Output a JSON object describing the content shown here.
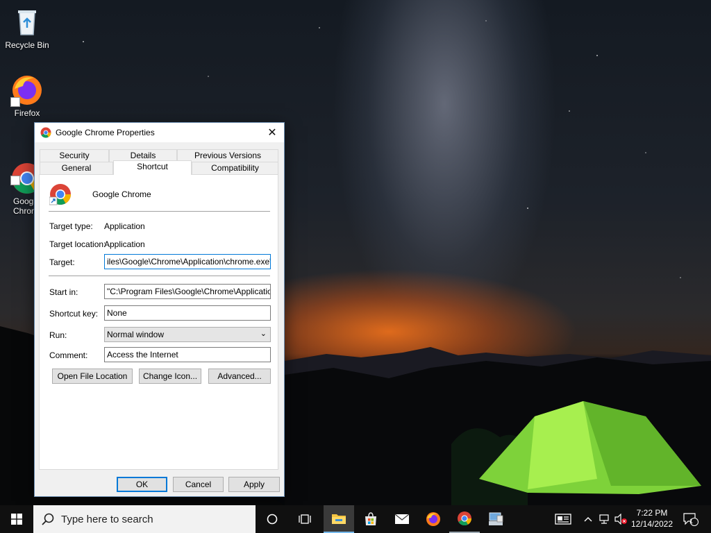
{
  "desktop": {
    "icons": [
      {
        "label": "Recycle Bin",
        "icon": "recycle-bin-icon"
      },
      {
        "label": "Firefox",
        "icon": "firefox-icon"
      },
      {
        "label": "Goog\nChron",
        "icon": "chrome-icon"
      }
    ]
  },
  "dialog": {
    "title": "Google Chrome Properties",
    "close_glyph": "✕",
    "tabs_row1": [
      "Security",
      "Details",
      "Previous Versions"
    ],
    "tabs_row2": [
      "General",
      "Shortcut",
      "Compatibility"
    ],
    "active_tab": "Shortcut",
    "app_name": "Google Chrome",
    "target_type_label": "Target type:",
    "target_type_value": "Application",
    "target_location_label": "Target location:",
    "target_location_value": "Application",
    "target_label": "Target:",
    "target_value": "iles\\Google\\Chrome\\Application\\chrome.exe\" --ig",
    "start_in_label": "Start in:",
    "start_in_value": "\"C:\\Program Files\\Google\\Chrome\\Application\"",
    "shortcut_key_label": "Shortcut key:",
    "shortcut_key_value": "None",
    "run_label": "Run:",
    "run_value": "Normal window",
    "comment_label": "Comment:",
    "comment_value": "Access the Internet",
    "buttons": {
      "open_file_location": "Open File Location",
      "change_icon": "Change Icon...",
      "advanced": "Advanced...",
      "ok": "OK",
      "cancel": "Cancel",
      "apply": "Apply"
    }
  },
  "taskbar": {
    "search_placeholder": "Type here to search",
    "time": "7:22 PM",
    "date": "12/14/2022",
    "notification_count": "1",
    "pinned": [
      "task-view",
      "file-explorer",
      "microsoft-store",
      "mail",
      "firefox",
      "chrome",
      "network-app"
    ]
  },
  "colors": {
    "accent": "#0078d7",
    "taskbar_bg": "#101010"
  }
}
